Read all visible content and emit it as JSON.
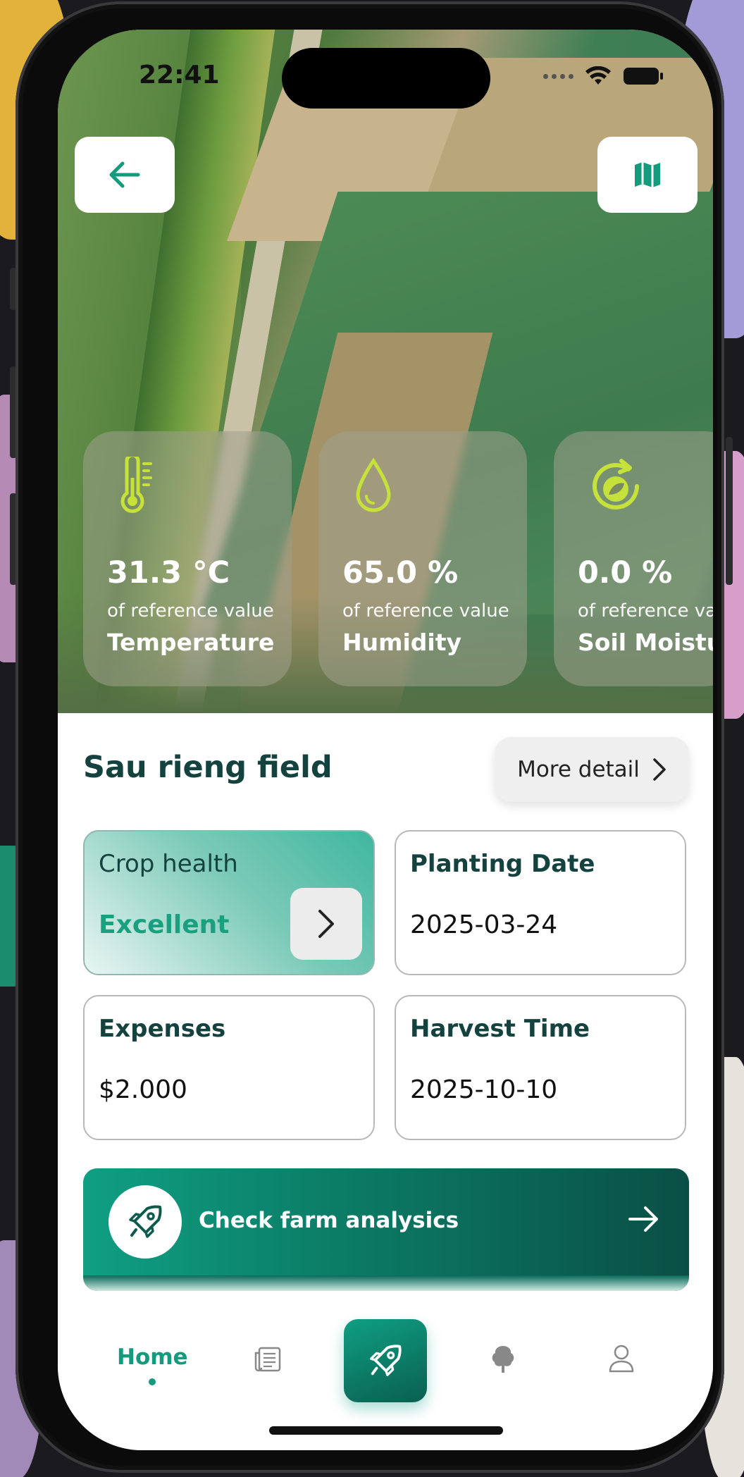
{
  "status_bar": {
    "time": "22:41"
  },
  "header": {
    "back_icon": "arrow-left-icon",
    "map_icon": "map-icon"
  },
  "metrics": [
    {
      "icon": "thermometer-icon",
      "value": "31.3 °C",
      "ref": "of reference value",
      "label": "Temperature"
    },
    {
      "icon": "droplet-icon",
      "value": "65.0 %",
      "ref": "of reference value",
      "label": "Humidity"
    },
    {
      "icon": "soil-refresh-icon",
      "value": "0.0 %",
      "ref": "of reference val",
      "label": "Soil Moistur"
    }
  ],
  "field": {
    "title": "Sau rieng field",
    "more_detail_label": "More detail"
  },
  "cards": {
    "crop_health": {
      "title": "Crop health",
      "value": "Excellent"
    },
    "planting_date": {
      "title": "Planting Date",
      "value": "2025-03-24"
    },
    "expenses": {
      "title": "Expenses",
      "value": "$2.000"
    },
    "harvest_time": {
      "title": "Harvest Time",
      "value": "2025-10-10"
    }
  },
  "cta": {
    "label": "Check farm analysics"
  },
  "tabbar": {
    "home_label": "Home",
    "items": [
      "home",
      "news-icon",
      "rocket-icon",
      "tree-icon",
      "profile-icon"
    ]
  },
  "colors": {
    "accent": "#149a7c",
    "dark_green": "#14423e",
    "lime_icon": "#c6e23a"
  }
}
